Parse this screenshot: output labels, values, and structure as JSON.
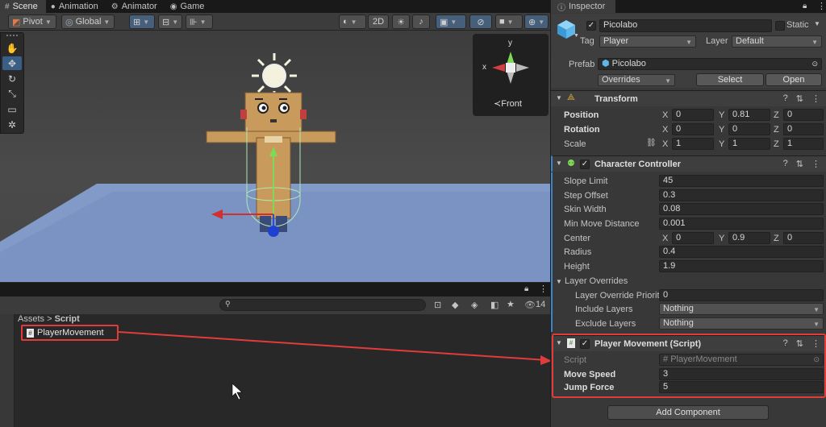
{
  "scene_tabs": [
    {
      "label": "Scene",
      "icon": "#"
    },
    {
      "label": "Animation",
      "icon": "●"
    },
    {
      "label": "Animator",
      "icon": "⚙"
    },
    {
      "label": "Game",
      "icon": "◉"
    }
  ],
  "scene_toolbar": {
    "pivot": "Pivot",
    "global": "Global",
    "mode_2d": "2D"
  },
  "gizmo": {
    "y": "y",
    "x": "x",
    "view": "Front",
    "view_prefix": "≺"
  },
  "project": {
    "breadcrumb_root": "Assets",
    "breadcrumb_sep": ">",
    "breadcrumb_folder": "Script",
    "file": "PlayerMovement",
    "visible_count": "14"
  },
  "inspector": {
    "tab": "Inspector",
    "object_name": "Picolabo",
    "static_label": "Static",
    "tag_label": "Tag",
    "tag_value": "Player",
    "layer_label": "Layer",
    "layer_value": "Default",
    "prefab_label": "Prefab",
    "prefab_value": "Picolabo",
    "overrides": "Overrides",
    "select": "Select",
    "open": "Open",
    "transform": {
      "title": "Transform",
      "position_label": "Position",
      "position": [
        "0",
        "0.81",
        "0"
      ],
      "rotation_label": "Rotation",
      "rotation": [
        "0",
        "0",
        "0"
      ],
      "scale_label": "Scale",
      "scale": [
        "1",
        "1",
        "1"
      ]
    },
    "axes": [
      "X",
      "Y",
      "Z"
    ],
    "cc": {
      "title": "Character Controller",
      "rows": [
        {
          "label": "Slope Limit",
          "value": "45"
        },
        {
          "label": "Step Offset",
          "value": "0.3"
        },
        {
          "label": "Skin Width",
          "value": "0.08"
        },
        {
          "label": "Min Move Distance",
          "value": "0.001"
        }
      ],
      "center_label": "Center",
      "center": [
        "0",
        "0.9",
        "0"
      ],
      "radius_label": "Radius",
      "radius": "0.4",
      "height_label": "Height",
      "height": "1.9",
      "layer_overrides": "Layer Overrides",
      "priority_label": "Layer Override Priority",
      "priority": "0",
      "include_label": "Include Layers",
      "include": "Nothing",
      "exclude_label": "Exclude Layers",
      "exclude": "Nothing"
    },
    "pm": {
      "title": "Player Movement (Script)",
      "script_label": "Script",
      "script_value": "PlayerMovement",
      "move_label": "Move Speed",
      "move_value": "3",
      "jump_label": "Jump Force",
      "jump_value": "5"
    },
    "add_component": "Add Component"
  },
  "highlight_color": "#e03c3c"
}
